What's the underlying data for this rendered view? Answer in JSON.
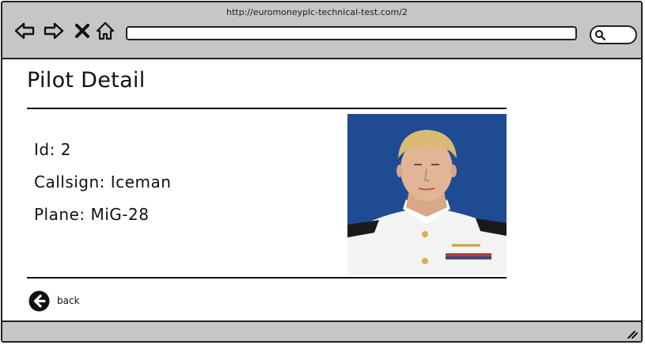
{
  "browser": {
    "url": "http://euromoneyplc-technical-test.com/2",
    "icons": {
      "back": "arrow-left-icon",
      "forward": "arrow-right-icon",
      "stop": "close-icon",
      "home": "home-icon",
      "search": "search-icon",
      "resize": "resize-grip-icon"
    }
  },
  "page": {
    "title": "Pilot Detail",
    "details": [
      {
        "label": "Id:",
        "value": "2"
      },
      {
        "label": "Callsign:",
        "value": "Iceman"
      },
      {
        "label": "Plane:",
        "value": "MiG-28"
      }
    ],
    "back_label": "back"
  },
  "colors": {
    "chrome": "#c6c6c6",
    "border": "#222222",
    "photo_background": "#1e4c93"
  }
}
